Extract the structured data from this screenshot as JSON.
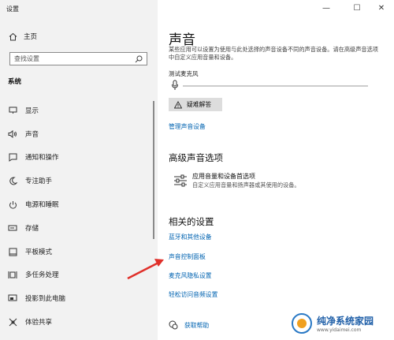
{
  "window": {
    "title": "设置"
  },
  "sidebar": {
    "home": "主页",
    "search_placeholder": "查找设置",
    "section": "系统",
    "items": [
      {
        "label": "显示",
        "icon": "display-icon"
      },
      {
        "label": "声音",
        "icon": "speaker-icon"
      },
      {
        "label": "通知和操作",
        "icon": "notification-icon"
      },
      {
        "label": "专注助手",
        "icon": "moon-icon"
      },
      {
        "label": "电源和睡眠",
        "icon": "power-icon"
      },
      {
        "label": "存储",
        "icon": "storage-icon"
      },
      {
        "label": "平板模式",
        "icon": "tablet-icon"
      },
      {
        "label": "多任务处理",
        "icon": "multitask-icon"
      },
      {
        "label": "投影到此电脑",
        "icon": "project-icon"
      },
      {
        "label": "体验共享",
        "icon": "share-icon"
      }
    ]
  },
  "main": {
    "title": "声音",
    "description": "某些应用可以设置为使用与此处选择的声音设备不同的声音设备。请在高级声音选项中自定义应用音量和设备。",
    "mic_test_label": "测试麦克风",
    "troubleshoot_button": "疑难解答",
    "manage_devices_link": "管理声音设备",
    "advanced_heading": "高级声音选项",
    "advanced_item_title": "应用音量和设备首选项",
    "advanced_item_sub": "自定义应用音量和扬声器或其使用的设备。",
    "related_heading": "相关的设置",
    "related_links": [
      "蓝牙和其他设备",
      "声音控制面板",
      "麦克风隐私设置",
      "轻松访问音频设置"
    ],
    "help_link": "获取帮助"
  },
  "window_controls": [
    "—",
    "☐",
    "✕"
  ],
  "watermark": {
    "name": "纯净系统家园",
    "url": "www.yidaimei.com"
  }
}
